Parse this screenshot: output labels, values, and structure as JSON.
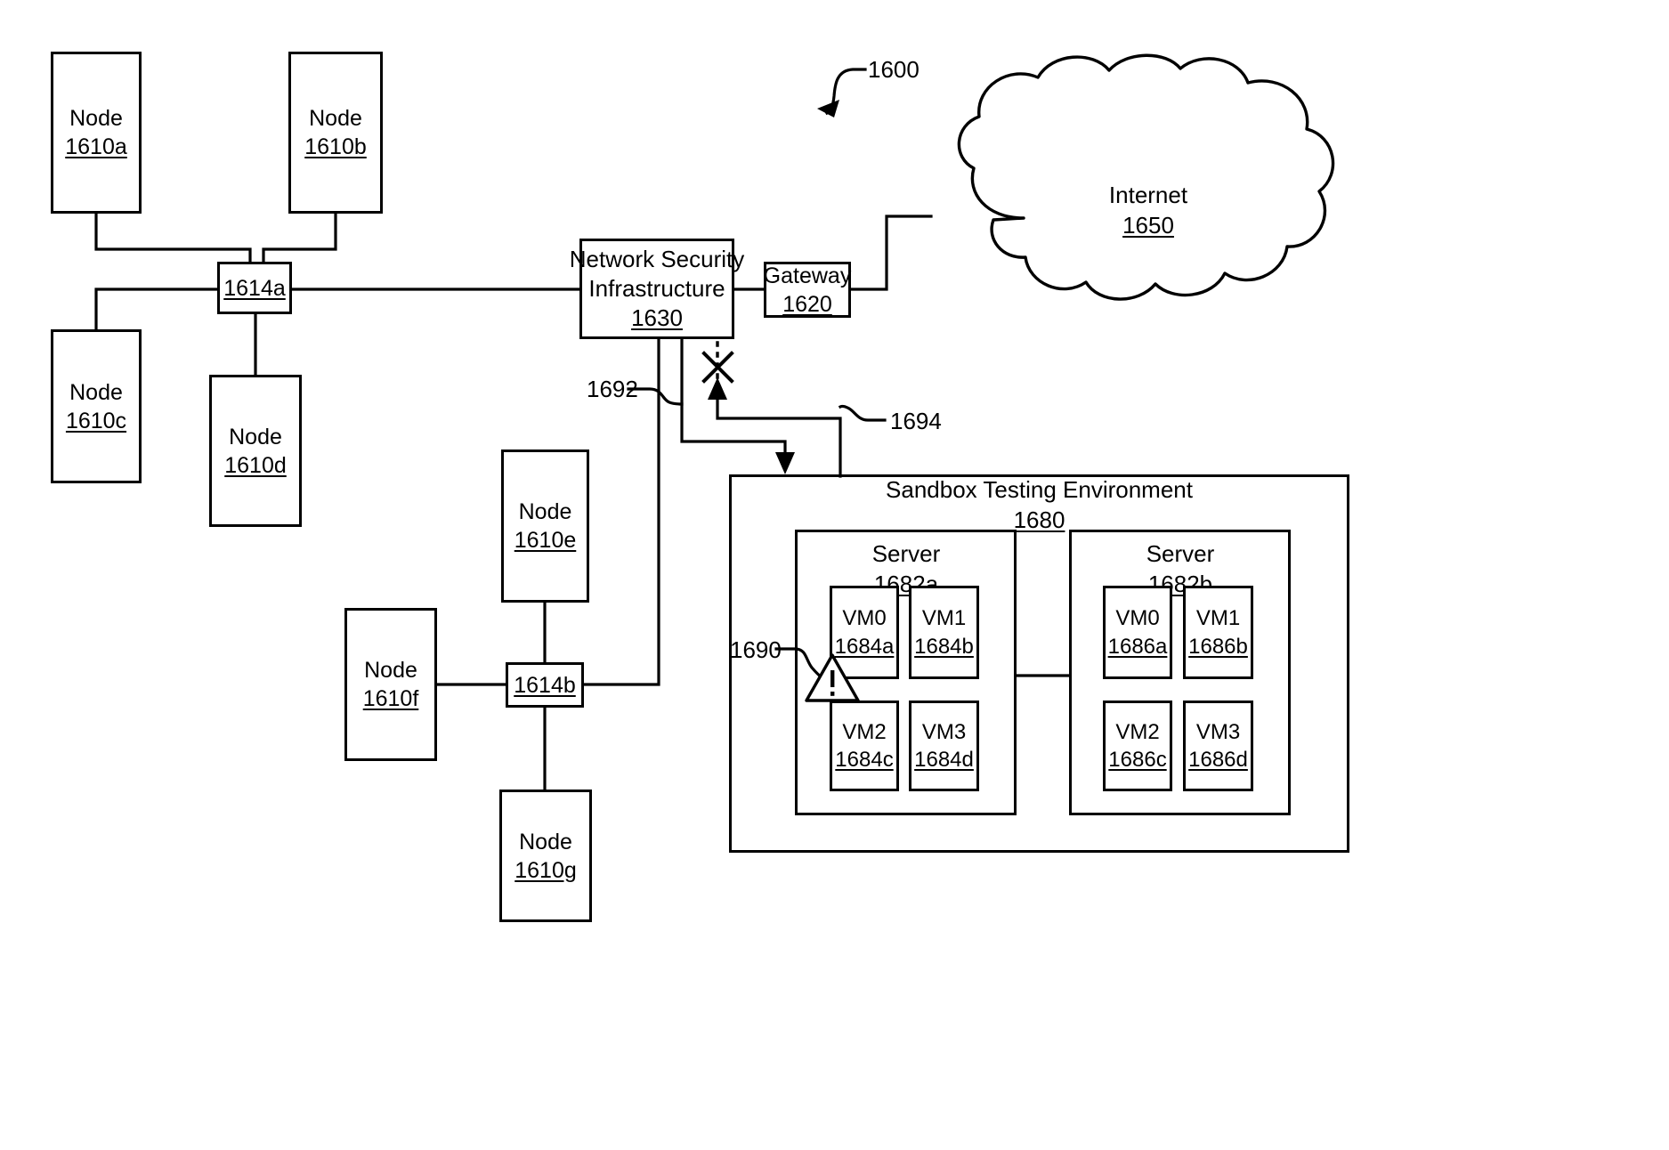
{
  "figure": {
    "reference": "1600",
    "type": "patent-network-diagram"
  },
  "nodes": [
    {
      "id": "n1610a",
      "label": "Node",
      "ref": "1610a"
    },
    {
      "id": "n1610b",
      "label": "Node",
      "ref": "1610b"
    },
    {
      "id": "n1610c",
      "label": "Node",
      "ref": "1610c"
    },
    {
      "id": "n1610d",
      "label": "Node",
      "ref": "1610d"
    },
    {
      "id": "n1610e",
      "label": "Node",
      "ref": "1610e"
    },
    {
      "id": "n1610f",
      "label": "Node",
      "ref": "1610f"
    },
    {
      "id": "n1610g",
      "label": "Node",
      "ref": "1610g"
    }
  ],
  "switches": [
    {
      "id": "sw1614a",
      "ref": "1614a"
    },
    {
      "id": "sw1614b",
      "ref": "1614b"
    }
  ],
  "security": {
    "label_line1": "Network Security",
    "label_line2": "Infrastructure",
    "ref": "1630"
  },
  "gateway": {
    "label": "Gateway",
    "ref": "1620"
  },
  "internet": {
    "label": "Internet",
    "ref": "1650"
  },
  "sandbox": {
    "label": "Sandbox Testing Environment",
    "ref": "1680",
    "servers": [
      {
        "label": "Server",
        "ref": "1682a",
        "vms": [
          {
            "name": "VM0",
            "ref": "1684a"
          },
          {
            "name": "VM1",
            "ref": "1684b"
          },
          {
            "name": "VM2",
            "ref": "1684c"
          },
          {
            "name": "VM3",
            "ref": "1684d"
          }
        ]
      },
      {
        "label": "Server",
        "ref": "1682b",
        "vms": [
          {
            "name": "VM0",
            "ref": "1686a"
          },
          {
            "name": "VM1",
            "ref": "1686b"
          },
          {
            "name": "VM2",
            "ref": "1686c"
          },
          {
            "name": "VM3",
            "ref": "1686d"
          }
        ]
      }
    ]
  },
  "callouts": {
    "figure": "1600",
    "redirect_path": "1692",
    "return_path": "1694",
    "threat_marker": "1690"
  },
  "symbols": {
    "blocked_link": "x-blocked-icon",
    "warning": "warning-triangle-icon"
  },
  "colors": {
    "line": "#000000",
    "background": "#ffffff"
  }
}
